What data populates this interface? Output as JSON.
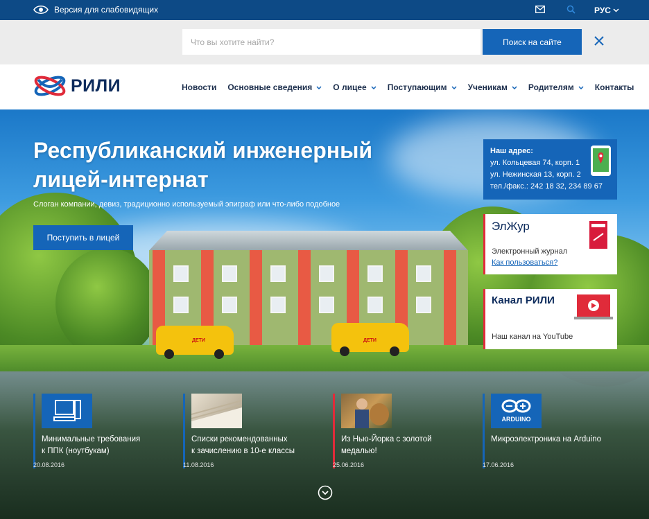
{
  "topbar": {
    "accessibility_label": "Версия для слабовидящих",
    "lang_label": "РУС",
    "icons": [
      "eye-icon",
      "mail-icon",
      "search-icon",
      "chevron-down-icon"
    ]
  },
  "search": {
    "placeholder": "Что вы хотите найти?",
    "button_label": "Поиск на сайте"
  },
  "header": {
    "logo_text": "РИЛИ",
    "nav": [
      {
        "label": "Новости",
        "has_dropdown": false
      },
      {
        "label": "Основные сведения",
        "has_dropdown": true
      },
      {
        "label": "О лицее",
        "has_dropdown": true
      },
      {
        "label": "Поступающим",
        "has_dropdown": true
      },
      {
        "label": "Ученикам",
        "has_dropdown": true
      },
      {
        "label": "Родителям",
        "has_dropdown": true
      },
      {
        "label": "Контакты",
        "has_dropdown": false
      }
    ]
  },
  "hero": {
    "title_line1": "Республиканский инженерный",
    "title_line2": "лицей-интернат",
    "slogan": "Слоган компании, девиз, традиционно используемый эпиграф или что-либо подобное",
    "apply_button": "Поступить в лицей",
    "bus_label": "ДЕТИ"
  },
  "address": {
    "title": "Наш адрес:",
    "line1": "ул. Кольцевая 74, корп. 1",
    "line2": "ул. Нежинская 13, корп. 2",
    "phone": "тел./факс.: 242 18 32, 234 89 67"
  },
  "cards": [
    {
      "title": "ЭлЖур",
      "subtitle": "Электронный журнал",
      "link": "Как пользоваться?"
    },
    {
      "title": "Канал РИЛИ",
      "subtitle": "Наш канал на YouTube"
    }
  ],
  "news": [
    {
      "title_line1": "Минимальные требования",
      "title_line2": "к ППК (ноутбукам)",
      "date": "20.08.2016",
      "accent": "#1565b8"
    },
    {
      "title_line1": "Списки рекомендованных",
      "title_line2": "к зачислению в 10-е классы",
      "date": "11.08.2016",
      "accent": "#1565b8"
    },
    {
      "title_line1": "Из Нью-Йорка с золотой",
      "title_line2": "медалью!",
      "date": "25.06.2016",
      "accent": "#e02b3a"
    },
    {
      "title_line1": "Микроэлектроника на Arduino",
      "title_line2": "",
      "date": "17.06.2016",
      "accent": "#1565b8"
    }
  ],
  "arduino_label": "ARDUINO",
  "colors": {
    "brand": "#1565b8",
    "topbar": "#0d4a86",
    "accent_red": "#e02b3a"
  }
}
